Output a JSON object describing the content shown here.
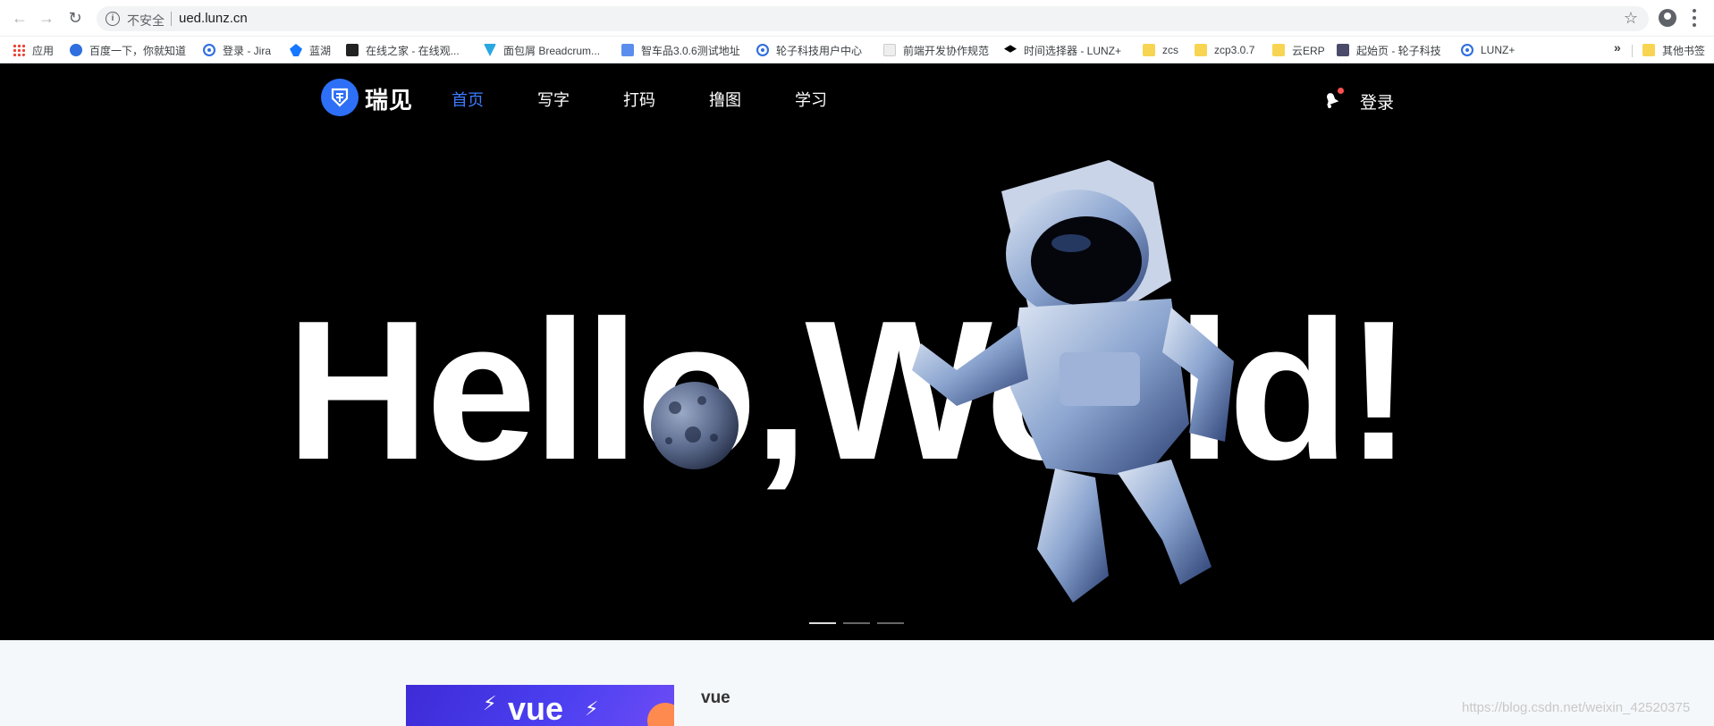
{
  "browser": {
    "security_label": "不安全",
    "url": "ued.lunz.cn",
    "icons": [
      "back-arrow-icon",
      "forward-arrow-icon",
      "reload-icon",
      "info-icon",
      "star-icon",
      "account-icon",
      "menu-icon"
    ]
  },
  "bookmarks": {
    "items": [
      {
        "label": "应用",
        "icon": "apps-grid-icon"
      },
      {
        "label": "百度一下，你就知道",
        "icon": "baidu-paw-icon"
      },
      {
        "label": "登录 - Jira",
        "icon": "gear-icon"
      },
      {
        "label": "蓝湖",
        "icon": "lanhu-icon"
      },
      {
        "label": "在线之家 - 在线观...",
        "icon": "clapper-icon"
      },
      {
        "label": "面包屑 Breadcrum...",
        "icon": "breadcrumb-icon"
      },
      {
        "label": "智车品3.0.6测试地址",
        "icon": "car-icon"
      },
      {
        "label": "轮子科技用户中心",
        "icon": "gear-icon"
      },
      {
        "label": "前端开发协作规范",
        "icon": "document-icon"
      },
      {
        "label": "时间选择器 - LUNZ+",
        "icon": "graduation-cap-icon"
      },
      {
        "label": "zcs",
        "icon": "folder-icon"
      },
      {
        "label": "zcp3.0.7",
        "icon": "folder-icon"
      },
      {
        "label": "云ERP",
        "icon": "folder-icon"
      },
      {
        "label": "起始页 - 轮子科技",
        "icon": "hr-icon"
      },
      {
        "label": "LUNZ+",
        "icon": "gear-icon"
      }
    ],
    "more": "»",
    "other": "其他书签"
  },
  "site": {
    "logo_text": "瑞见",
    "nav": [
      "首页",
      "写字",
      "打码",
      "撸图",
      "学习"
    ],
    "active_nav": "首页",
    "login": "登录",
    "accent_color": "#3d7bff"
  },
  "hero": {
    "title": "Hello,World!",
    "slides": 3,
    "active_slide": 1
  },
  "content": {
    "thumb_text": "vue",
    "card_title": "vue",
    "watermark": "https://blog.csdn.net/weixin_42520375"
  }
}
